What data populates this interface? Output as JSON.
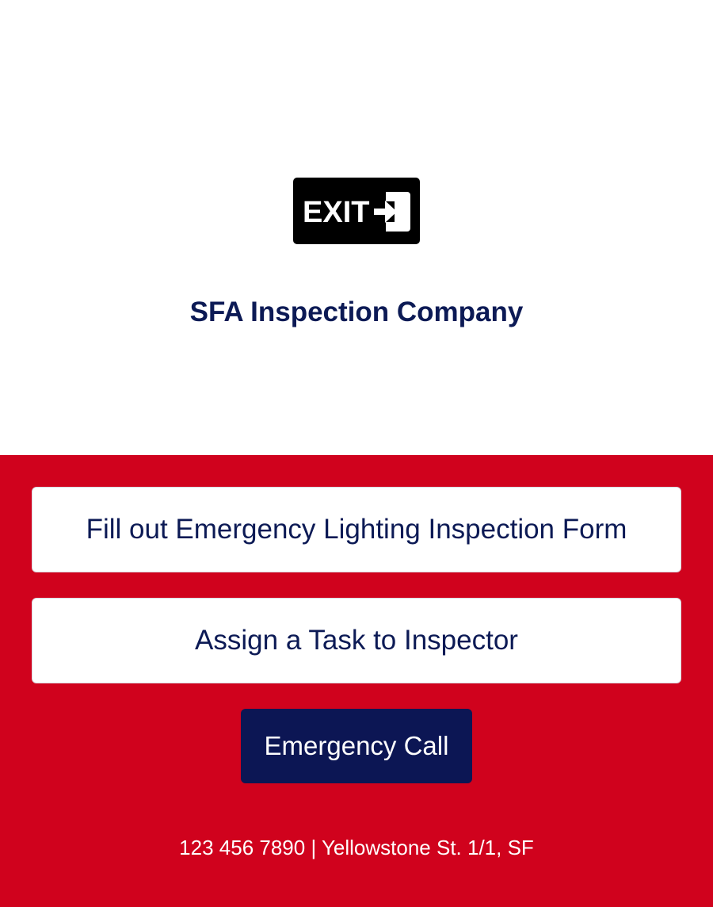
{
  "logo": {
    "text": "EXIT",
    "icon": "exit-arrow-icon",
    "background": "#000000",
    "foreground": "#ffffff"
  },
  "company": {
    "name": "SFA Inspection Company"
  },
  "actions": {
    "form_button_label": "Fill out Emergency Lighting Inspection Form",
    "task_button_label": "Assign a Task to Inspector",
    "call_button_label": "Emergency Call"
  },
  "footer": {
    "contact": "123 456 7890 | Yellowstone St. 1/1, SF"
  },
  "colors": {
    "brand_red": "#d0021d",
    "brand_navy": "#0c1a55",
    "white": "#ffffff"
  }
}
